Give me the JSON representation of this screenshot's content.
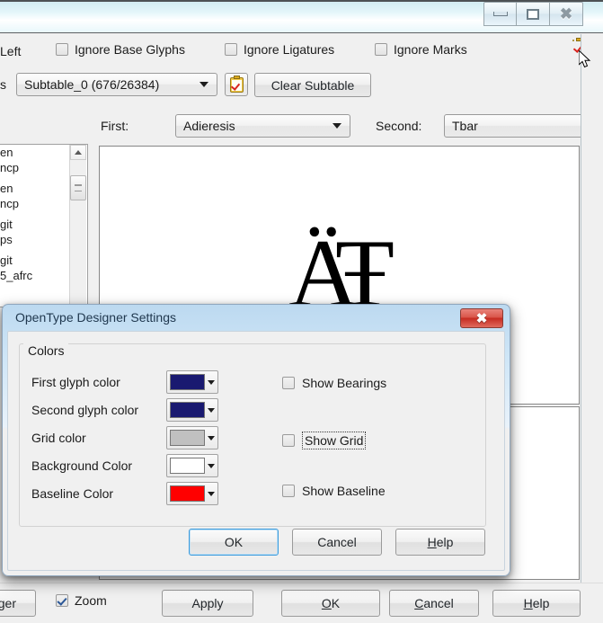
{
  "window": {
    "caption_buttons": [
      {
        "name": "minimize",
        "label": "—"
      },
      {
        "name": "maximize",
        "label": "□"
      },
      {
        "name": "close",
        "label": "✕"
      }
    ]
  },
  "toolbar": {
    "left_label": "Left",
    "checkboxes": [
      {
        "label": "Ignore Base Glyphs",
        "checked": false
      },
      {
        "label": "Ignore Ligatures",
        "checked": false
      },
      {
        "label": "Ignore Marks",
        "checked": false
      }
    ],
    "copy_icon": "clipboard-check-icon",
    "subtable_prefix_label": "s",
    "subtable_value": "Subtable_0 (676/26384)",
    "subtable_icon": "clipboard-check-icon",
    "clear_subtable_label": "Clear Subtable"
  },
  "pair": {
    "first_label": "First:",
    "first_value": "Adieresis",
    "second_label": "Second:",
    "second_value": "Tbar"
  },
  "glyph_list": {
    "items": [
      "en",
      "ncp",
      "en",
      "ncp",
      "git",
      "ps",
      "git",
      "5_afrc"
    ],
    "scroll_up_icon": "triangle-up-icon"
  },
  "preview": {
    "glyph_text": "ÄŦ"
  },
  "dialog": {
    "title": "OpenType Designer Settings",
    "close_label": "✕",
    "group_label": "Colors",
    "color_rows": [
      {
        "label": "First glyph color",
        "color": "#191970",
        "name": "first-glyph-color"
      },
      {
        "label": "Second glyph color",
        "color": "#191970",
        "name": "second-glyph-color"
      },
      {
        "label": "Grid color",
        "color": "#c0c0c0",
        "name": "grid-color"
      },
      {
        "label": "Background Color",
        "color": "#ffffff",
        "name": "background-color"
      },
      {
        "label": "Baseline Color",
        "color": "#ff0000",
        "name": "baseline-color"
      }
    ],
    "checkboxes": [
      {
        "label": "Show Bearings",
        "checked": false,
        "focused": false,
        "name": "show-bearings"
      },
      {
        "label": "Show Grid",
        "checked": false,
        "focused": true,
        "name": "show-grid"
      },
      {
        "label": "Show Baseline",
        "checked": false,
        "focused": false,
        "name": "show-baseline"
      }
    ],
    "buttons": [
      {
        "label": "OK",
        "default": true,
        "name": "ok"
      },
      {
        "label": "Cancel",
        "default": false,
        "name": "cancel"
      },
      {
        "label": "Help",
        "default": false,
        "name": "help",
        "accel": "H"
      }
    ]
  },
  "bottombar": {
    "manager_label": "ager",
    "zoom_label": "Zoom",
    "zoom_checked": true,
    "buttons": [
      {
        "label": "Apply",
        "name": "apply"
      },
      {
        "label": "OK",
        "name": "ok",
        "accel": "O"
      },
      {
        "label": "Cancel",
        "name": "cancel",
        "accel": "C"
      },
      {
        "label": "Help",
        "name": "help",
        "accel": "H"
      }
    ]
  }
}
